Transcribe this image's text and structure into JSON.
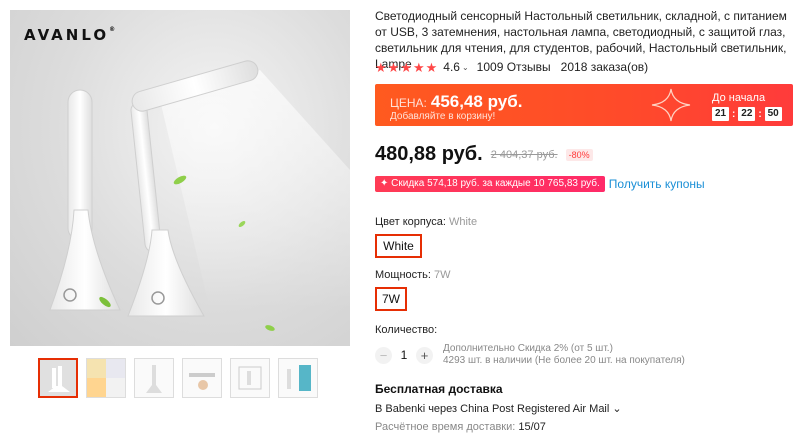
{
  "gallery": {
    "brand_logo": "AVANLO",
    "brand_mark": "®",
    "thumbnails": [
      {
        "name": "thumbnail-1",
        "active": true
      },
      {
        "name": "thumbnail-2",
        "active": false
      },
      {
        "name": "thumbnail-3",
        "active": false
      },
      {
        "name": "thumbnail-4",
        "active": false
      },
      {
        "name": "thumbnail-5",
        "active": false
      },
      {
        "name": "thumbnail-6",
        "active": false
      }
    ]
  },
  "product": {
    "title": "Светодиодный сенсорный Настольный светильник, складной, с питанием от USB, 3 затемнения, настольная лампа, светодиодный, с защитой глаз, светильник для чтения, для студентов, рабочий, Настольный светильник, Lampe",
    "rating": "4.6",
    "stars": 5,
    "reviews": "1009 Отзывы",
    "orders": "2018 заказа(ов)"
  },
  "promo": {
    "label": "ЦЕНА:",
    "price": "456,48 руб.",
    "subtext": "Добавляйте в корзину!",
    "countdown_label": "До начала",
    "countdown": {
      "h": "21",
      "m": "22",
      "s": "50"
    },
    "sep": ":"
  },
  "price": {
    "current": "480,88 руб.",
    "old": "2 404,37 руб.",
    "discount": "-80%"
  },
  "coupon": {
    "badge": "✦ Скидка 574,18 руб. за каждые 10 765,83 руб.",
    "link": "Получить купоны"
  },
  "options": {
    "color_label": "Цвет корпуса:",
    "color_value": "White",
    "color_selected": "White",
    "power_label": "Мощность:",
    "power_value": "7W",
    "power_selected": "7W"
  },
  "quantity": {
    "label": "Количество:",
    "value": "1",
    "minus": "−",
    "plus": "+",
    "info_line1": "Дополнительно Скидка 2% (от 5 шт.)",
    "info_line2": "4293 шт. в наличии (Не более 20 шт. на покупателя)"
  },
  "shipping": {
    "title": "Бесплатная доставка",
    "destination": "В Babenki через China Post Registered Air Mail ⌄",
    "eta_label": "Расчётное время доставки:",
    "eta_value": "15/07"
  },
  "colors": {
    "accent": "#ff4747",
    "promo_bg": "#ff4a2a",
    "link": "#1a8fd6",
    "selected_border": "#e62e04"
  }
}
